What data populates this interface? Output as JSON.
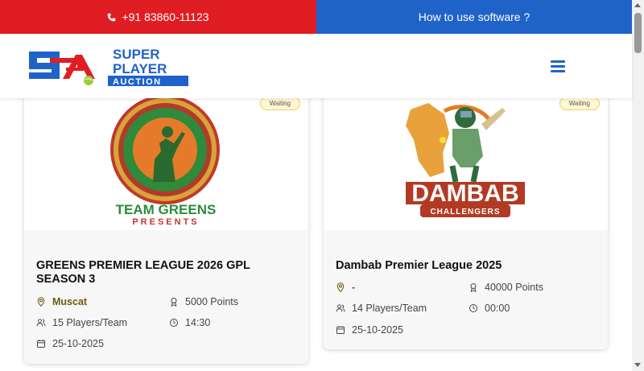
{
  "topbar": {
    "phone": "+91 83860-11123",
    "howto": "How to use software ?",
    "colors": {
      "phone_bg": "#e11d24",
      "howto_bg": "#1f63c9"
    }
  },
  "header": {
    "logo": {
      "line1": "SUPER",
      "line2": "PLAYER",
      "line3": "AUCTION"
    },
    "menu_icon": "hamburger-icon"
  },
  "cards": [
    {
      "status": "Waiting",
      "logo_text": "TEAM GREENS",
      "logo_subtext": "PRESENTS",
      "title": "GREENS PREMIER LEAGUE 2026 GPL SEASON 3",
      "location": "Muscat",
      "points": "5000 Points",
      "players": "15 Players/Team",
      "time": "14:30",
      "date": "25-10-2025"
    },
    {
      "status": "Waiting",
      "logo_text": "DAMBAB",
      "logo_subtext": "CHALLENGERS",
      "title": "Dambab Premier League 2025",
      "location": "-",
      "points": "40000 Points",
      "players": "14 Players/Team",
      "time": "00:00",
      "date": "25-10-2025"
    }
  ]
}
